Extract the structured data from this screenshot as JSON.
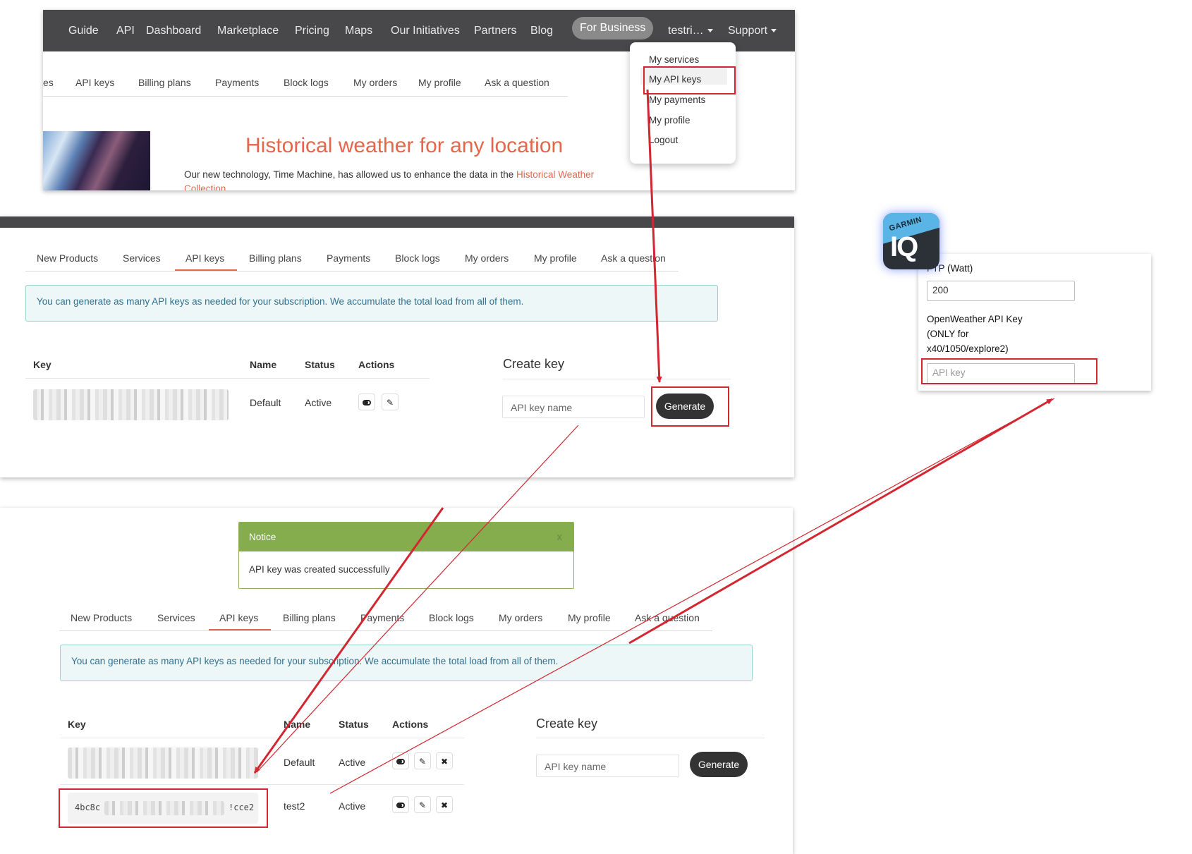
{
  "topnav": {
    "items": [
      "Guide",
      "API",
      "Dashboard",
      "Marketplace",
      "Pricing",
      "Maps",
      "Our Initiatives",
      "Partners",
      "Blog"
    ],
    "business": "For Business",
    "user": "testri…",
    "support": "Support"
  },
  "dropdown": {
    "items": [
      "My services",
      "My API keys",
      "My payments",
      "My profile",
      "Logout"
    ]
  },
  "p1": {
    "subnav_cut": "es",
    "subnav": [
      "API keys",
      "Billing plans",
      "Payments",
      "Block logs",
      "My orders",
      "My profile",
      "Ask a question"
    ],
    "hero_title": "Historical weather for any location",
    "hero_text": "Our new technology, Time Machine, has allowed us to enhance the data in the ",
    "hero_link": "Historical Weather Collection",
    "hero_end": "."
  },
  "tabs": [
    "New Products",
    "Services",
    "API keys",
    "Billing plans",
    "Payments",
    "Block logs",
    "My orders",
    "My profile",
    "Ask a question"
  ],
  "alert": "You can generate as many API keys as needed for your subscription. We accumulate the total load from all of them.",
  "table": {
    "headers": [
      "Key",
      "Name",
      "Status",
      "Actions"
    ],
    "rows": [
      {
        "name": "Default",
        "status": "Active"
      },
      {
        "key": "4bc8c",
        "key_end": "!cce2",
        "name": "test2",
        "status": "Active"
      }
    ]
  },
  "create": {
    "title": "Create key",
    "placeholder": "API key name",
    "button": "Generate"
  },
  "notice": {
    "title": "Notice",
    "close": "x",
    "message": "API key was created successfully"
  },
  "garmin": {
    "brand": "GARMIN",
    "logo": "IQ",
    "ftp_label": "FTP (Watt)",
    "ftp_value": "200",
    "api_label_1": "OpenWeather API Key",
    "api_label_2": "(ONLY for",
    "api_label_3": "x40/1050/explore2)",
    "api_placeholder": "API key"
  },
  "colors": {
    "accent": "#e2674b",
    "highlight": "#d22630",
    "nav": "#48484a",
    "notice": "#85ad4e"
  }
}
